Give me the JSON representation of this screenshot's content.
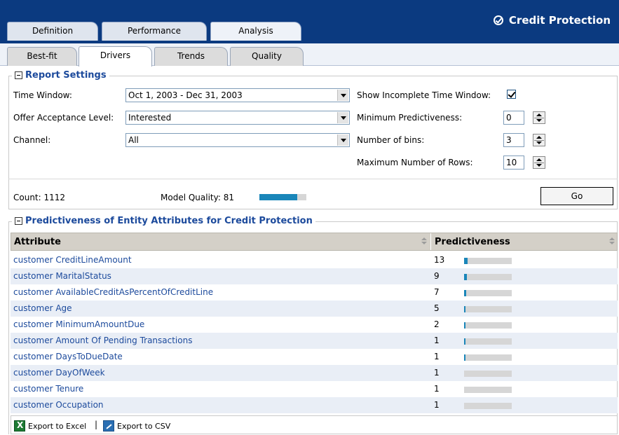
{
  "app": {
    "title": "Credit Protection"
  },
  "tabs": [
    {
      "label": "Definition"
    },
    {
      "label": "Performance"
    },
    {
      "label": "Analysis"
    }
  ],
  "subtabs": [
    {
      "label": "Best-fit"
    },
    {
      "label": "Drivers"
    },
    {
      "label": "Trends"
    },
    {
      "label": "Quality"
    }
  ],
  "settings": {
    "title": "Report Settings",
    "time_window_label": "Time Window:",
    "time_window_value": "Oct 1, 2003 - Dec 31, 2003",
    "acceptance_label": "Offer Acceptance Level:",
    "acceptance_value": "Interested",
    "channel_label": "Channel:",
    "channel_value": "All",
    "show_incomplete_label": "Show Incomplete Time Window:",
    "show_incomplete_checked": true,
    "min_pred_label": "Minimum Predictiveness:",
    "min_pred_value": "0",
    "bins_label": "Number of bins:",
    "bins_value": "3",
    "max_rows_label": "Maximum Number of Rows:",
    "max_rows_value": "10",
    "count_label": "Count: 1112",
    "model_quality_label": "Model Quality: 81",
    "model_quality_value": 81,
    "go_label": "Go"
  },
  "table": {
    "title": "Predictiveness of Entity Attributes for Credit Protection",
    "col_attribute": "Attribute",
    "col_predictiveness": "Predictiveness",
    "rows": [
      {
        "attribute": "customer CreditLineAmount",
        "value": "13",
        "level": 0.13
      },
      {
        "attribute": "customer MaritalStatus",
        "value": "9",
        "level": 0.09
      },
      {
        "attribute": "customer AvailableCreditAsPercentOfCreditLine",
        "value": "7",
        "level": 0.07
      },
      {
        "attribute": "customer Age",
        "value": "5",
        "level": 0.05
      },
      {
        "attribute": "customer MinimumAmountDue",
        "value": "2",
        "level": 0.02
      },
      {
        "attribute": "customer Amount Of Pending Transactions",
        "value": "1",
        "level": 0.01
      },
      {
        "attribute": "customer DaysToDueDate",
        "value": "1",
        "level": 0.01
      },
      {
        "attribute": "customer DayOfWeek",
        "value": "1",
        "level": 0.0
      },
      {
        "attribute": "customer Tenure",
        "value": "1",
        "level": 0.0
      },
      {
        "attribute": "customer Occupation",
        "value": "1",
        "level": 0.0
      }
    ]
  },
  "footer": {
    "export_excel": "Export to Excel",
    "separator": "|",
    "export_csv": "Export to CSV"
  },
  "colors": {
    "header_bg": "#0b3a80",
    "accent": "#1a86b9",
    "link": "#1c4a9c"
  }
}
